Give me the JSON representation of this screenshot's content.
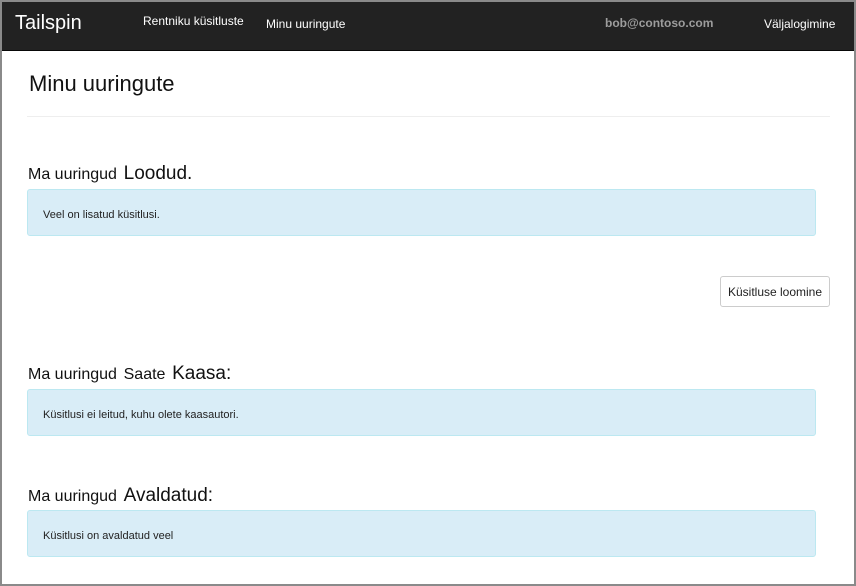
{
  "navbar": {
    "brand": "Tailspin",
    "links": {
      "tenant_surveys": "Rentniku küsitluste",
      "my_surveys": "Minu uuringute"
    },
    "user_email": "bob@contoso.com",
    "logout": "Väljalogimine"
  },
  "page": {
    "title": "Minu uuringute"
  },
  "sections": {
    "created": {
      "prefix": "Ma uuringud",
      "label": "Loodud.",
      "message": "Veel on lisatud küsitlusi."
    },
    "coauthor": {
      "prefix": "Ma uuringud",
      "middle": "Saate",
      "label": "Kaasa:",
      "message": "Küsitlusi ei leitud, kuhu olete kaasautori."
    },
    "published": {
      "prefix": "Ma uuringud",
      "label": "Avaldatud:",
      "message": "Küsitlusi on avaldatud veel"
    }
  },
  "actions": {
    "create_survey": "Küsitluse loomine"
  }
}
